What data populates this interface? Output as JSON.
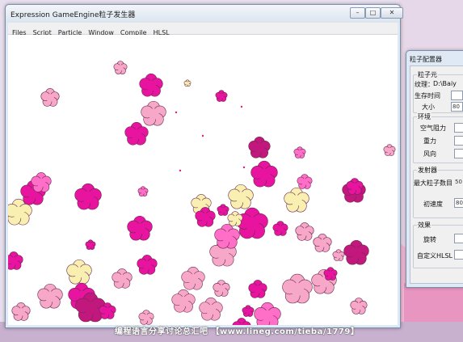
{
  "window": {
    "title": "Expression GameEngine粒子发生器",
    "controls": {
      "minimize": "–",
      "maximize": "□",
      "close": "✕"
    }
  },
  "menu": [
    "Files",
    "Script",
    "Particle",
    "Window",
    "Compile",
    "HLSL"
  ],
  "canvas": {
    "particle": "flower",
    "colors": [
      "#e8139e",
      "#ff6ec7",
      "#f7a8c8",
      "#f9efb1",
      "#c2187d"
    ]
  },
  "dialog": {
    "title": "粒子配置器",
    "groups": {
      "element": {
        "label": "粒子元",
        "texture_label": "纹理：",
        "texture_value": "D:\\Baiy",
        "lifetime_label": "生存时间",
        "size_label": "大小",
        "size_value": "80"
      },
      "environment": {
        "label": "环境",
        "air_resistance_label": "空气阻力",
        "gravity_label": "重力",
        "wind_label": "风向"
      },
      "emitter": {
        "label": "发射器",
        "max_particles_label": "最大粒子数目",
        "max_particles_value": "50",
        "initial_speed_label": "初速度",
        "initial_speed_value": "80"
      },
      "effects": {
        "label": "效果",
        "rotate_label": "旋转",
        "custom_hlsl_label": "自定义HLSL"
      }
    }
  },
  "watermark": "编程语言分享讨论总汇吧 【www.lineg.com/tieba/1779】"
}
